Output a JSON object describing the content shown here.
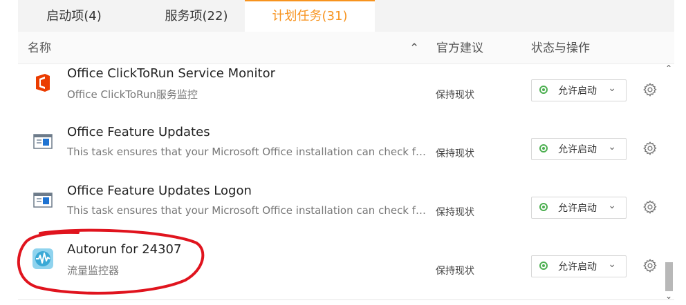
{
  "tabs": [
    {
      "label": "启动项(4)"
    },
    {
      "label": "服务项(22)"
    },
    {
      "label": "计划任务(31)"
    }
  ],
  "header": {
    "name": "名称",
    "sort_glyph": "⌃",
    "advice": "官方建议",
    "status": "状态与操作"
  },
  "rows": [
    {
      "title": "Office ClickToRun Service Monitor",
      "desc": "Office ClickToRun服务监控",
      "advice": "保持现状",
      "status": "允许启动",
      "icon": "office-icon"
    },
    {
      "title": "Office Feature Updates",
      "desc": "This task ensures that your Microsoft Office installation can check for f...",
      "advice": "保持现状",
      "status": "允许启动",
      "icon": "task-window-icon"
    },
    {
      "title": "Office Feature Updates Logon",
      "desc": "This task ensures that your Microsoft Office installation can check for f...",
      "advice": "保持现状",
      "status": "允许启动",
      "icon": "task-window-icon"
    },
    {
      "title": "Autorun for 24307",
      "desc": "流量监控器",
      "advice": "保持现状",
      "status": "允许启动",
      "icon": "waveform-icon"
    }
  ],
  "colors": {
    "active_tab": "#f7931e",
    "status_dot": "#4caf50",
    "annotation": "#e0141e"
  }
}
